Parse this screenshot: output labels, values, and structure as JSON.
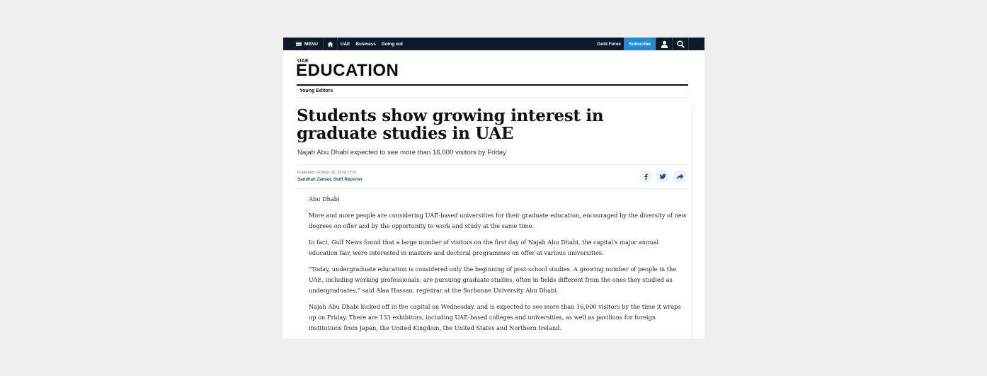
{
  "topnav": {
    "menu_label": "MENU",
    "links": [
      "UAE",
      "Business",
      "Going out"
    ],
    "right_link": "Gold Forex",
    "subscribe_label": "Subscribe"
  },
  "colors": {
    "nav_bg": "#0b1b2b",
    "subscribe_bg": "#1f8bd6",
    "byline": "#1e4f7a"
  },
  "icons": {
    "menu": "hamburger-icon",
    "home": "home-icon",
    "user": "user-icon",
    "search": "search-icon",
    "facebook": "facebook-icon",
    "twitter": "twitter-icon",
    "share": "share-arrow-icon"
  },
  "section": {
    "kicker": "UAE",
    "title": "EDUCATION",
    "subnav": "Young Editors"
  },
  "article": {
    "headline": "Students show growing interest in graduate studies in UAE",
    "subheading": "Najah Abu Dhabi expected to see more than 16,000 visitors by Friday",
    "published": "Published:  October 30, 2019 17:20",
    "byline": "Samihah Zaman, Staff Reporter",
    "paragraphs": [
      "Abu Dhabi",
      "More and more people are considering UAE-based universities for their graduate education, encouraged by the diversity of new degrees on offer and by the opportunity to work and study at the same time.",
      "In fact, Gulf News found that a large number of visitors on the first day of Najah Abu Dhabi, the capital's major annual education fair, were interested in masters and doctoral programmes on offer at various universities.",
      "“Today, undergraduate education is considered only the beginning of post-school studies. A growing number of people in the UAE, including working professionals, are pursuing graduate studies, often in fields different from the ones they studied as undergraduates,” said Alaa Hassan, registrar at the Sorbonne University Abu Dhabi.",
      "Najah Abu Dhabi kicked off in the capital on Wednesday, and is expected to see more than 16,000 visitors by the time it wraps up on Friday. There are 133 exhibitors, including UAE-based colleges and universities, as well as pavilions for foreign institutions from Japan, the United Kingdom, the United States and Northern Ireland."
    ]
  }
}
